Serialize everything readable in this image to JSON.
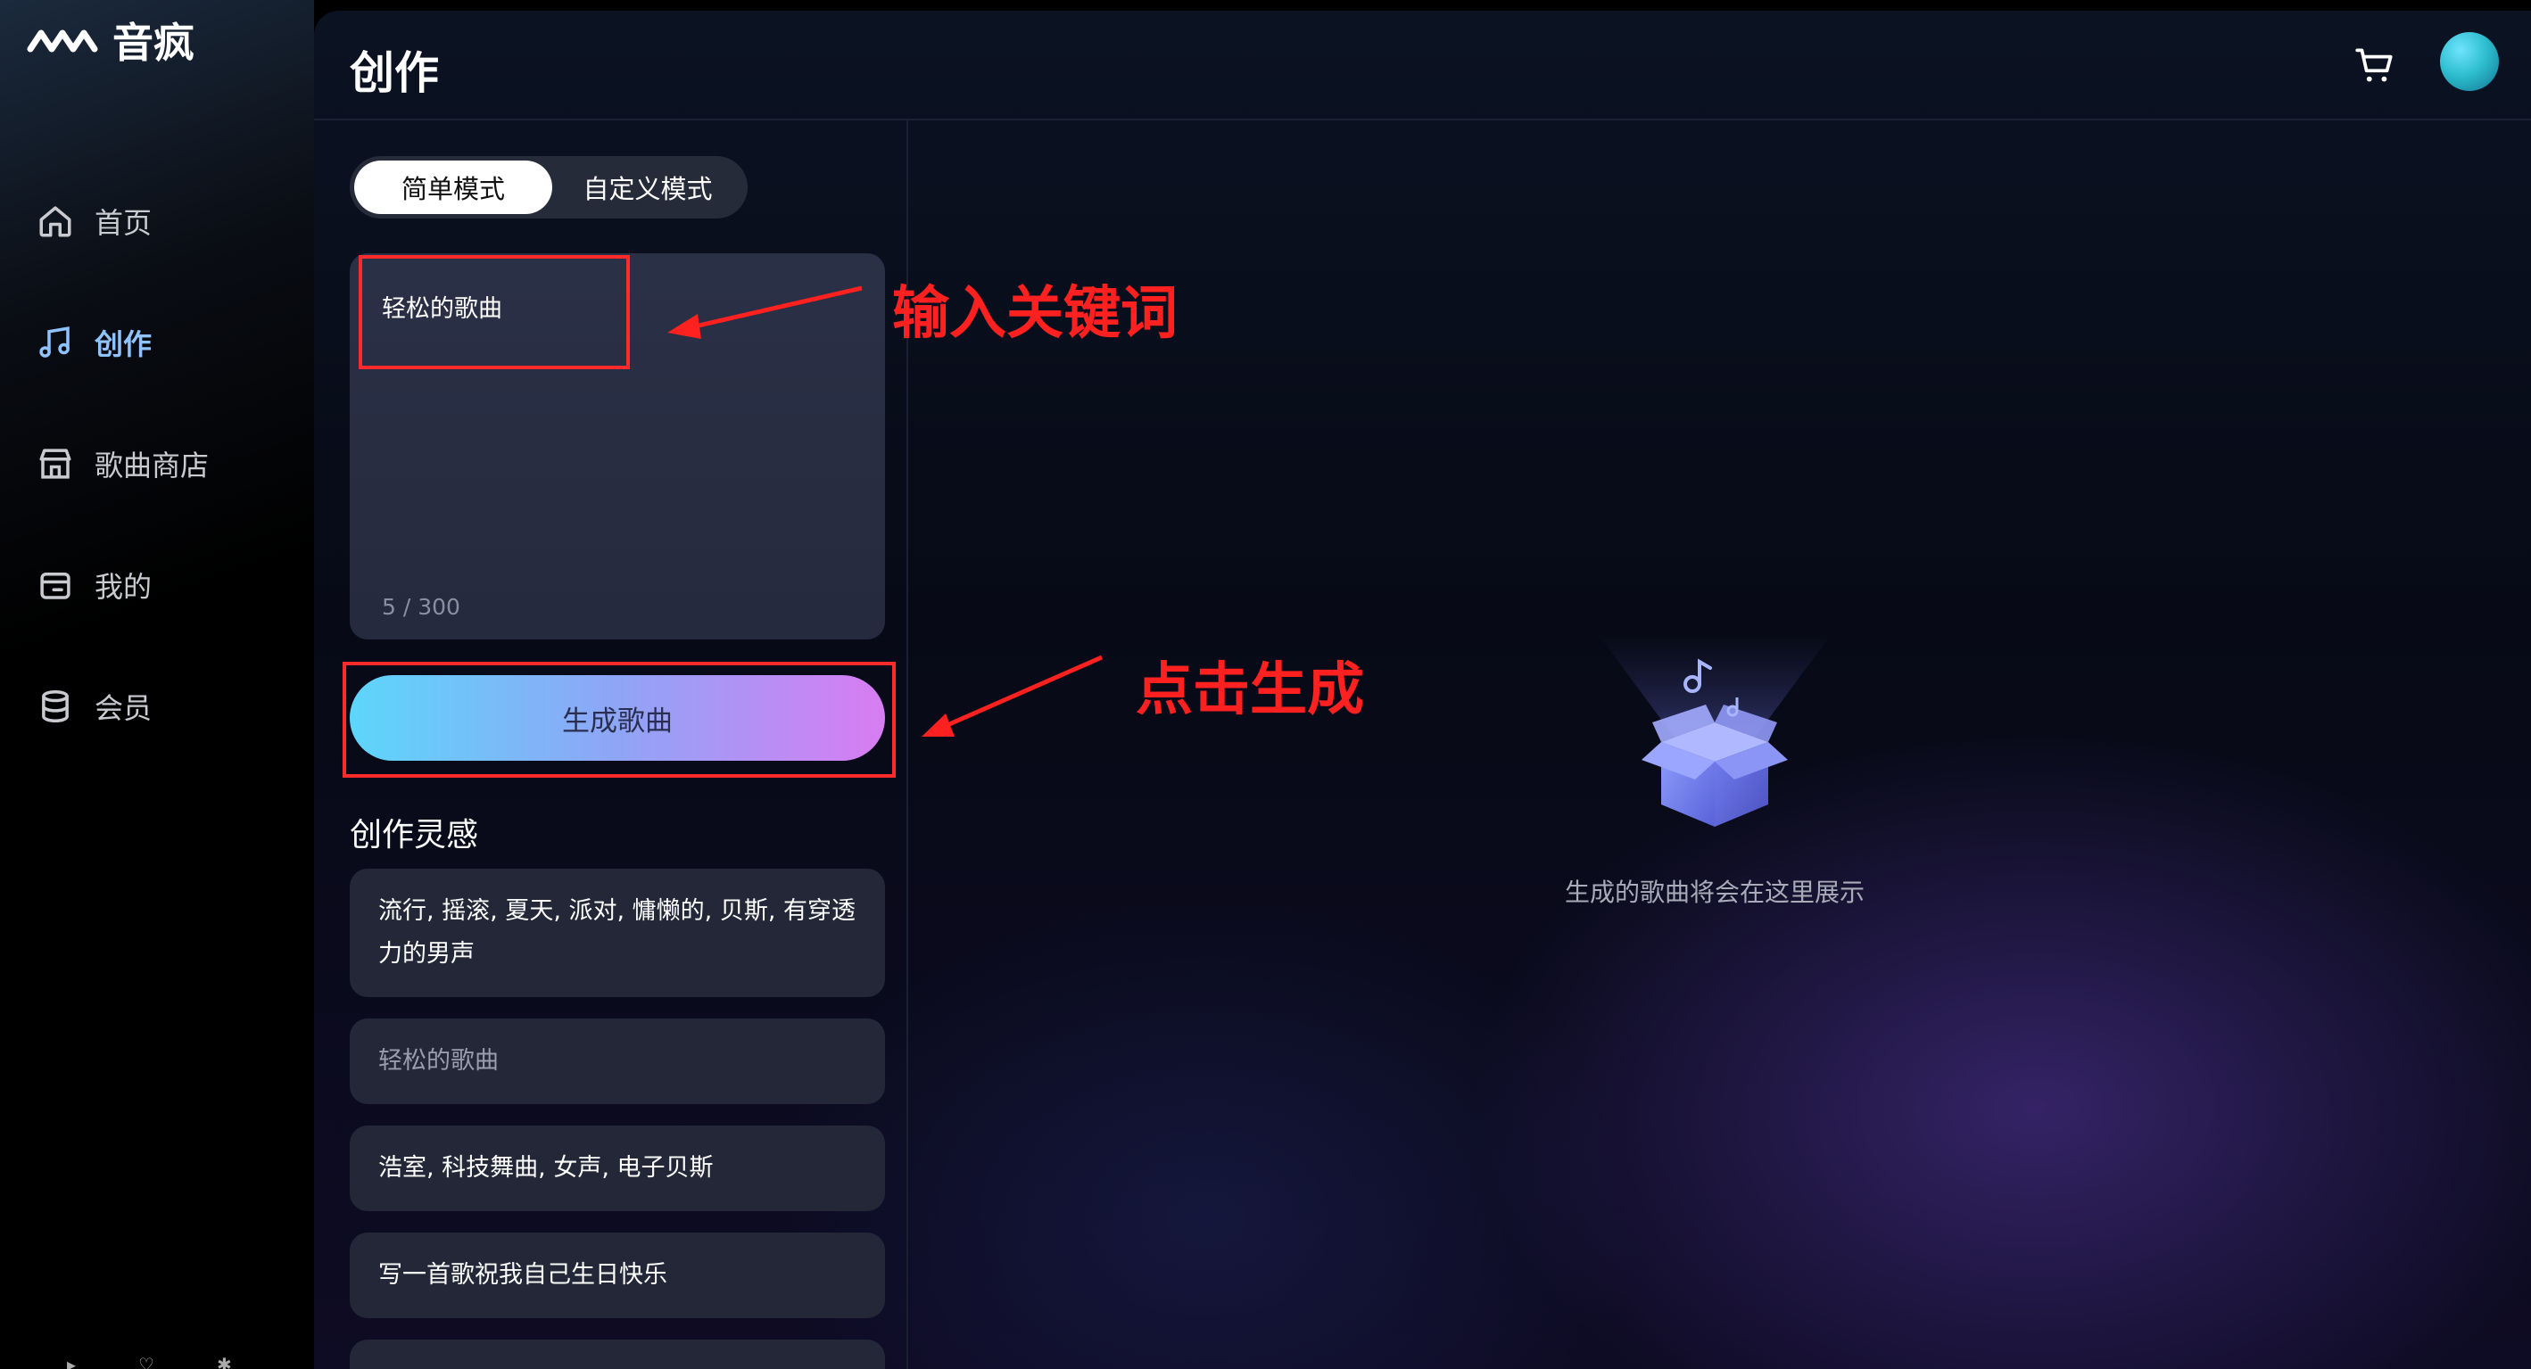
{
  "app": {
    "name": "音疯",
    "brand_color": "#8fc3ff"
  },
  "sidebar": {
    "items": [
      {
        "label": "首页",
        "icon": "home-icon",
        "active": false
      },
      {
        "label": "创作",
        "icon": "music-note-icon",
        "active": true
      },
      {
        "label": "歌曲商店",
        "icon": "store-icon",
        "active": false
      },
      {
        "label": "我的",
        "icon": "wallet-icon",
        "active": false
      },
      {
        "label": "会员",
        "icon": "database-icon",
        "active": false
      }
    ]
  },
  "header": {
    "title": "创作",
    "cart_icon": "cart-icon",
    "avatar_icon": "avatar"
  },
  "mode_tabs": {
    "simple": "简单模式",
    "custom": "自定义模式",
    "selected": "简单模式"
  },
  "prompt": {
    "value": "轻松的歌曲",
    "counter": "5 / 300"
  },
  "generate_button": {
    "label": "生成歌曲"
  },
  "inspiration": {
    "title": "创作灵感",
    "items": [
      "流行, 摇滚, 夏天, 派对, 慵懒的, 贝斯, 有穿透力的男声",
      "轻松的歌曲",
      "浩室, 科技舞曲, 女声, 电子贝斯",
      "写一首歌祝我自己生日快乐"
    ]
  },
  "empty_state": {
    "text": "生成的歌曲将会在这里展示",
    "icon": "open-box-music-icon"
  },
  "annotations": {
    "input_hint": "输入关键词",
    "click_hint": "点击生成",
    "color": "#ff2020"
  }
}
